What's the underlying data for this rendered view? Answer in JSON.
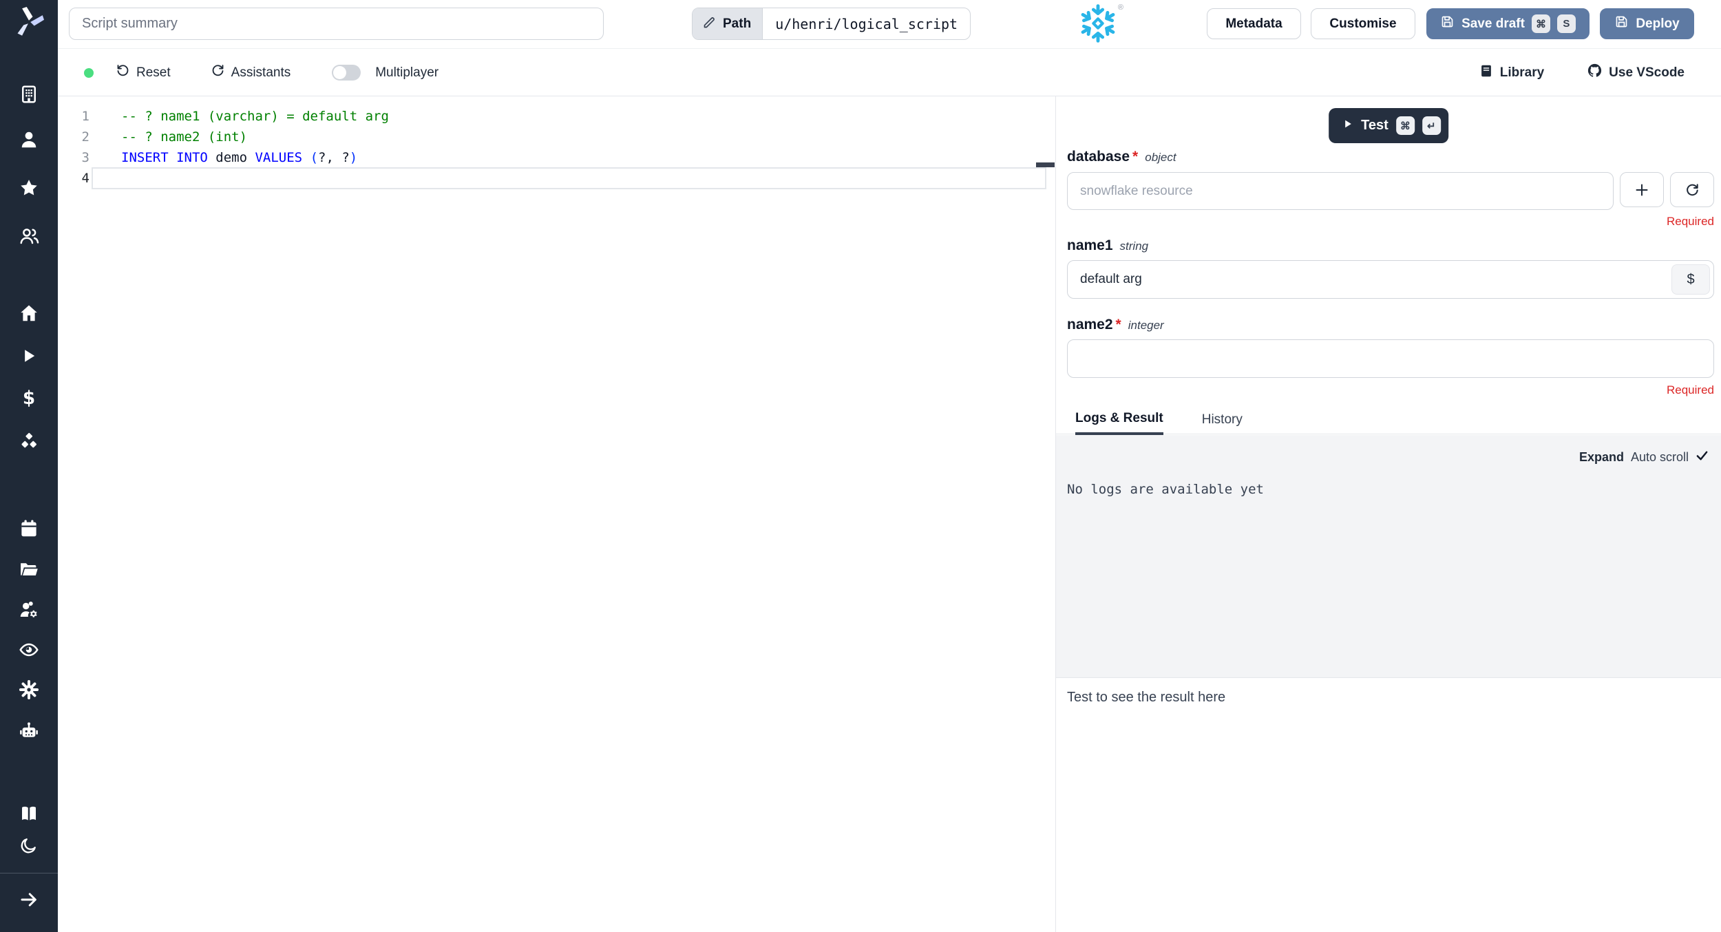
{
  "colors": {
    "sidebar_bg": "#1f2937",
    "accent_button_blue": "#5e7aa3",
    "test_button_dark": "#252f3f",
    "status_green": "#4ade80",
    "required_red": "#dc2626",
    "snowflake_blue": "#29b5e8",
    "comment_green": "#008000",
    "keyword_blue": "#0000ff",
    "logs_bg": "#f3f4f6"
  },
  "sidebar": {
    "icons": [
      "windmill-logo",
      "building",
      "person",
      "star",
      "user-group",
      "home",
      "play",
      "dollar",
      "cubes",
      "calendar",
      "folder",
      "user-cog",
      "eye",
      "gear",
      "robot",
      "book",
      "moon",
      "arrow-right"
    ]
  },
  "topbar": {
    "summary_placeholder": "Script summary",
    "path_label": "Path",
    "path_value": "u/henri/logical_script",
    "snowflake_reg": "®",
    "metadata_label": "Metadata",
    "customise_label": "Customise",
    "save_draft_label": "Save draft",
    "save_draft_kbd": [
      "⌘",
      "S"
    ],
    "deploy_label": "Deploy"
  },
  "toolbar": {
    "reset_label": "Reset",
    "assistants_label": "Assistants",
    "multiplayer_label": "Multiplayer",
    "library_label": "Library",
    "vscode_label": "Use VScode"
  },
  "editor": {
    "lines": [
      {
        "num": "1",
        "text": "-- ? name1 (varchar) = default arg"
      },
      {
        "num": "2",
        "text": "-- ? name2 (int)"
      },
      {
        "num": "3",
        "kw1": "INSERT INTO",
        "plain": " demo ",
        "kw2": "VALUES",
        "open": " (",
        "mid": "?, ?",
        "close": ")"
      },
      {
        "num": "4"
      }
    ]
  },
  "panel": {
    "test_label": "Test",
    "test_kbd": [
      "⌘",
      "↵"
    ],
    "star": "*",
    "dollar_label": "$",
    "fields": [
      {
        "name": "database",
        "type": "object",
        "required": true,
        "placeholder": "snowflake resource",
        "required_label": "Required"
      },
      {
        "name": "name1",
        "type": "string",
        "required": false,
        "value": "default arg"
      },
      {
        "name": "name2",
        "type": "integer",
        "required": true,
        "required_label": "Required"
      }
    ],
    "tabs": [
      {
        "label": "Logs & Result",
        "active": true
      },
      {
        "label": "History",
        "active": false
      }
    ],
    "expand_label": "Expand",
    "autoscroll_label": "Auto scroll",
    "no_logs_text": "No logs are available yet",
    "result_hint": "Test to see the result here"
  }
}
